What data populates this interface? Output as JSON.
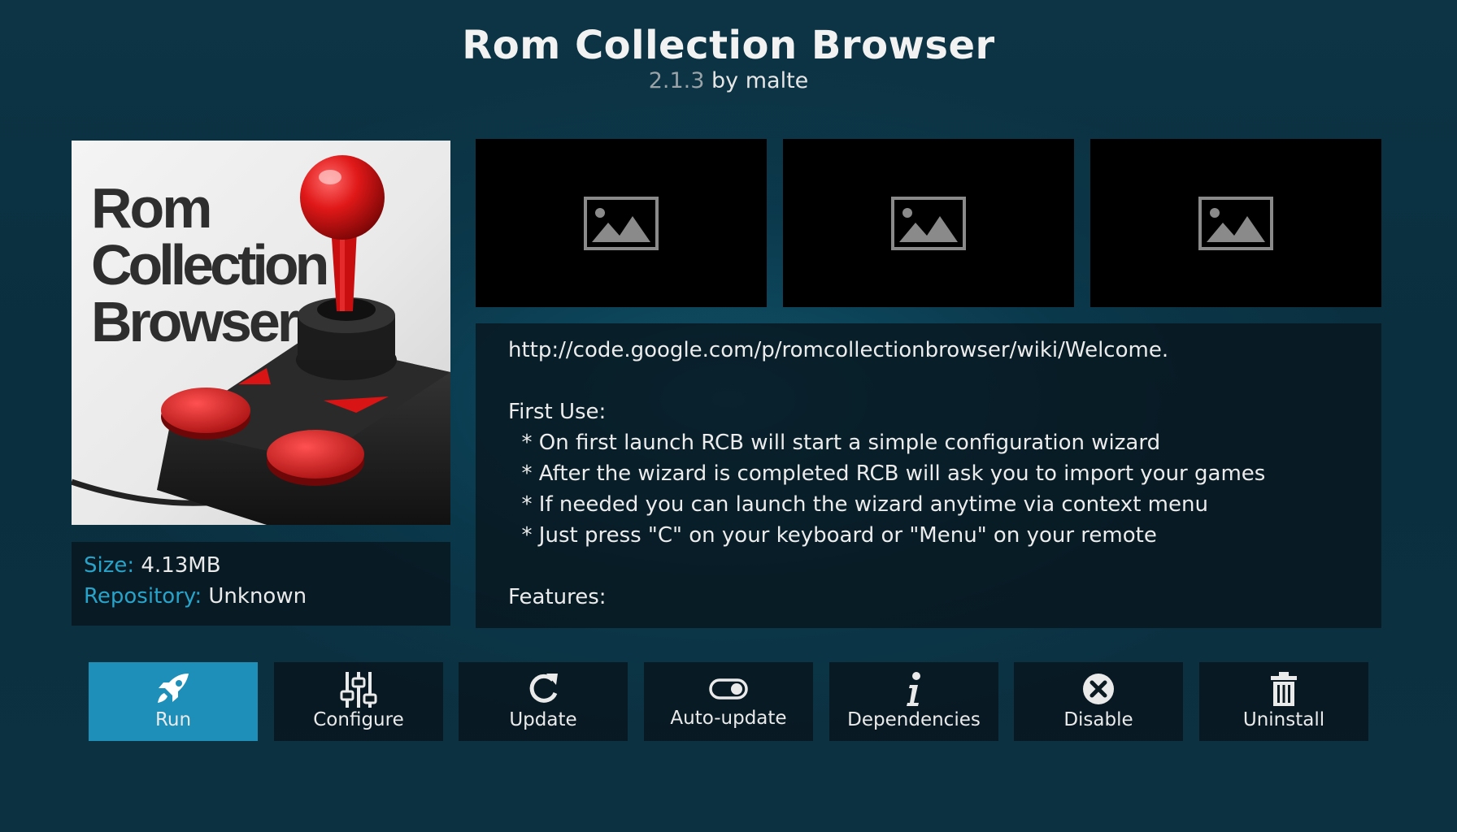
{
  "addon": {
    "title": "Rom Collection Browser",
    "version": "2.1.3",
    "by_label": "by",
    "author": "malte"
  },
  "logo": {
    "line1": "Rom",
    "line2": "Collection",
    "line3": "Browser"
  },
  "info": {
    "size_label": "Size:",
    "size_value": "4.13MB",
    "repository_label": "Repository:",
    "repository_value": "Unknown"
  },
  "screenshots": [
    {
      "icon": "image-placeholder-icon"
    },
    {
      "icon": "image-placeholder-icon"
    },
    {
      "icon": "image-placeholder-icon"
    }
  ],
  "description": {
    "lines": [
      "http://code.google.com/p/romcollectionbrowser/wiki/Welcome.",
      "",
      "First Use:",
      "  * On first launch RCB will start a simple configuration wizard",
      "  * After the wizard is completed RCB will ask you to import your games",
      "  * If needed you can launch the wizard anytime via context menu",
      "  * Just press \"C\" on your keyboard or \"Menu\" on your remote",
      "",
      "Features:"
    ]
  },
  "actions": [
    {
      "label": "Run",
      "icon": "rocket-icon",
      "active": true
    },
    {
      "label": "Configure",
      "icon": "sliders-icon",
      "active": false
    },
    {
      "label": "Update",
      "icon": "refresh-icon",
      "active": false
    },
    {
      "label": "Auto-update",
      "icon": "toggle-icon",
      "active": false
    },
    {
      "label": "Dependencies",
      "icon": "info-icon",
      "active": false
    },
    {
      "label": "Disable",
      "icon": "close-circle-icon",
      "active": false
    },
    {
      "label": "Uninstall",
      "icon": "trash-icon",
      "active": false
    }
  ],
  "colors": {
    "accent": "#1e8fb8",
    "label_blue": "#28a3c9",
    "joystick_red": "#d81414"
  }
}
